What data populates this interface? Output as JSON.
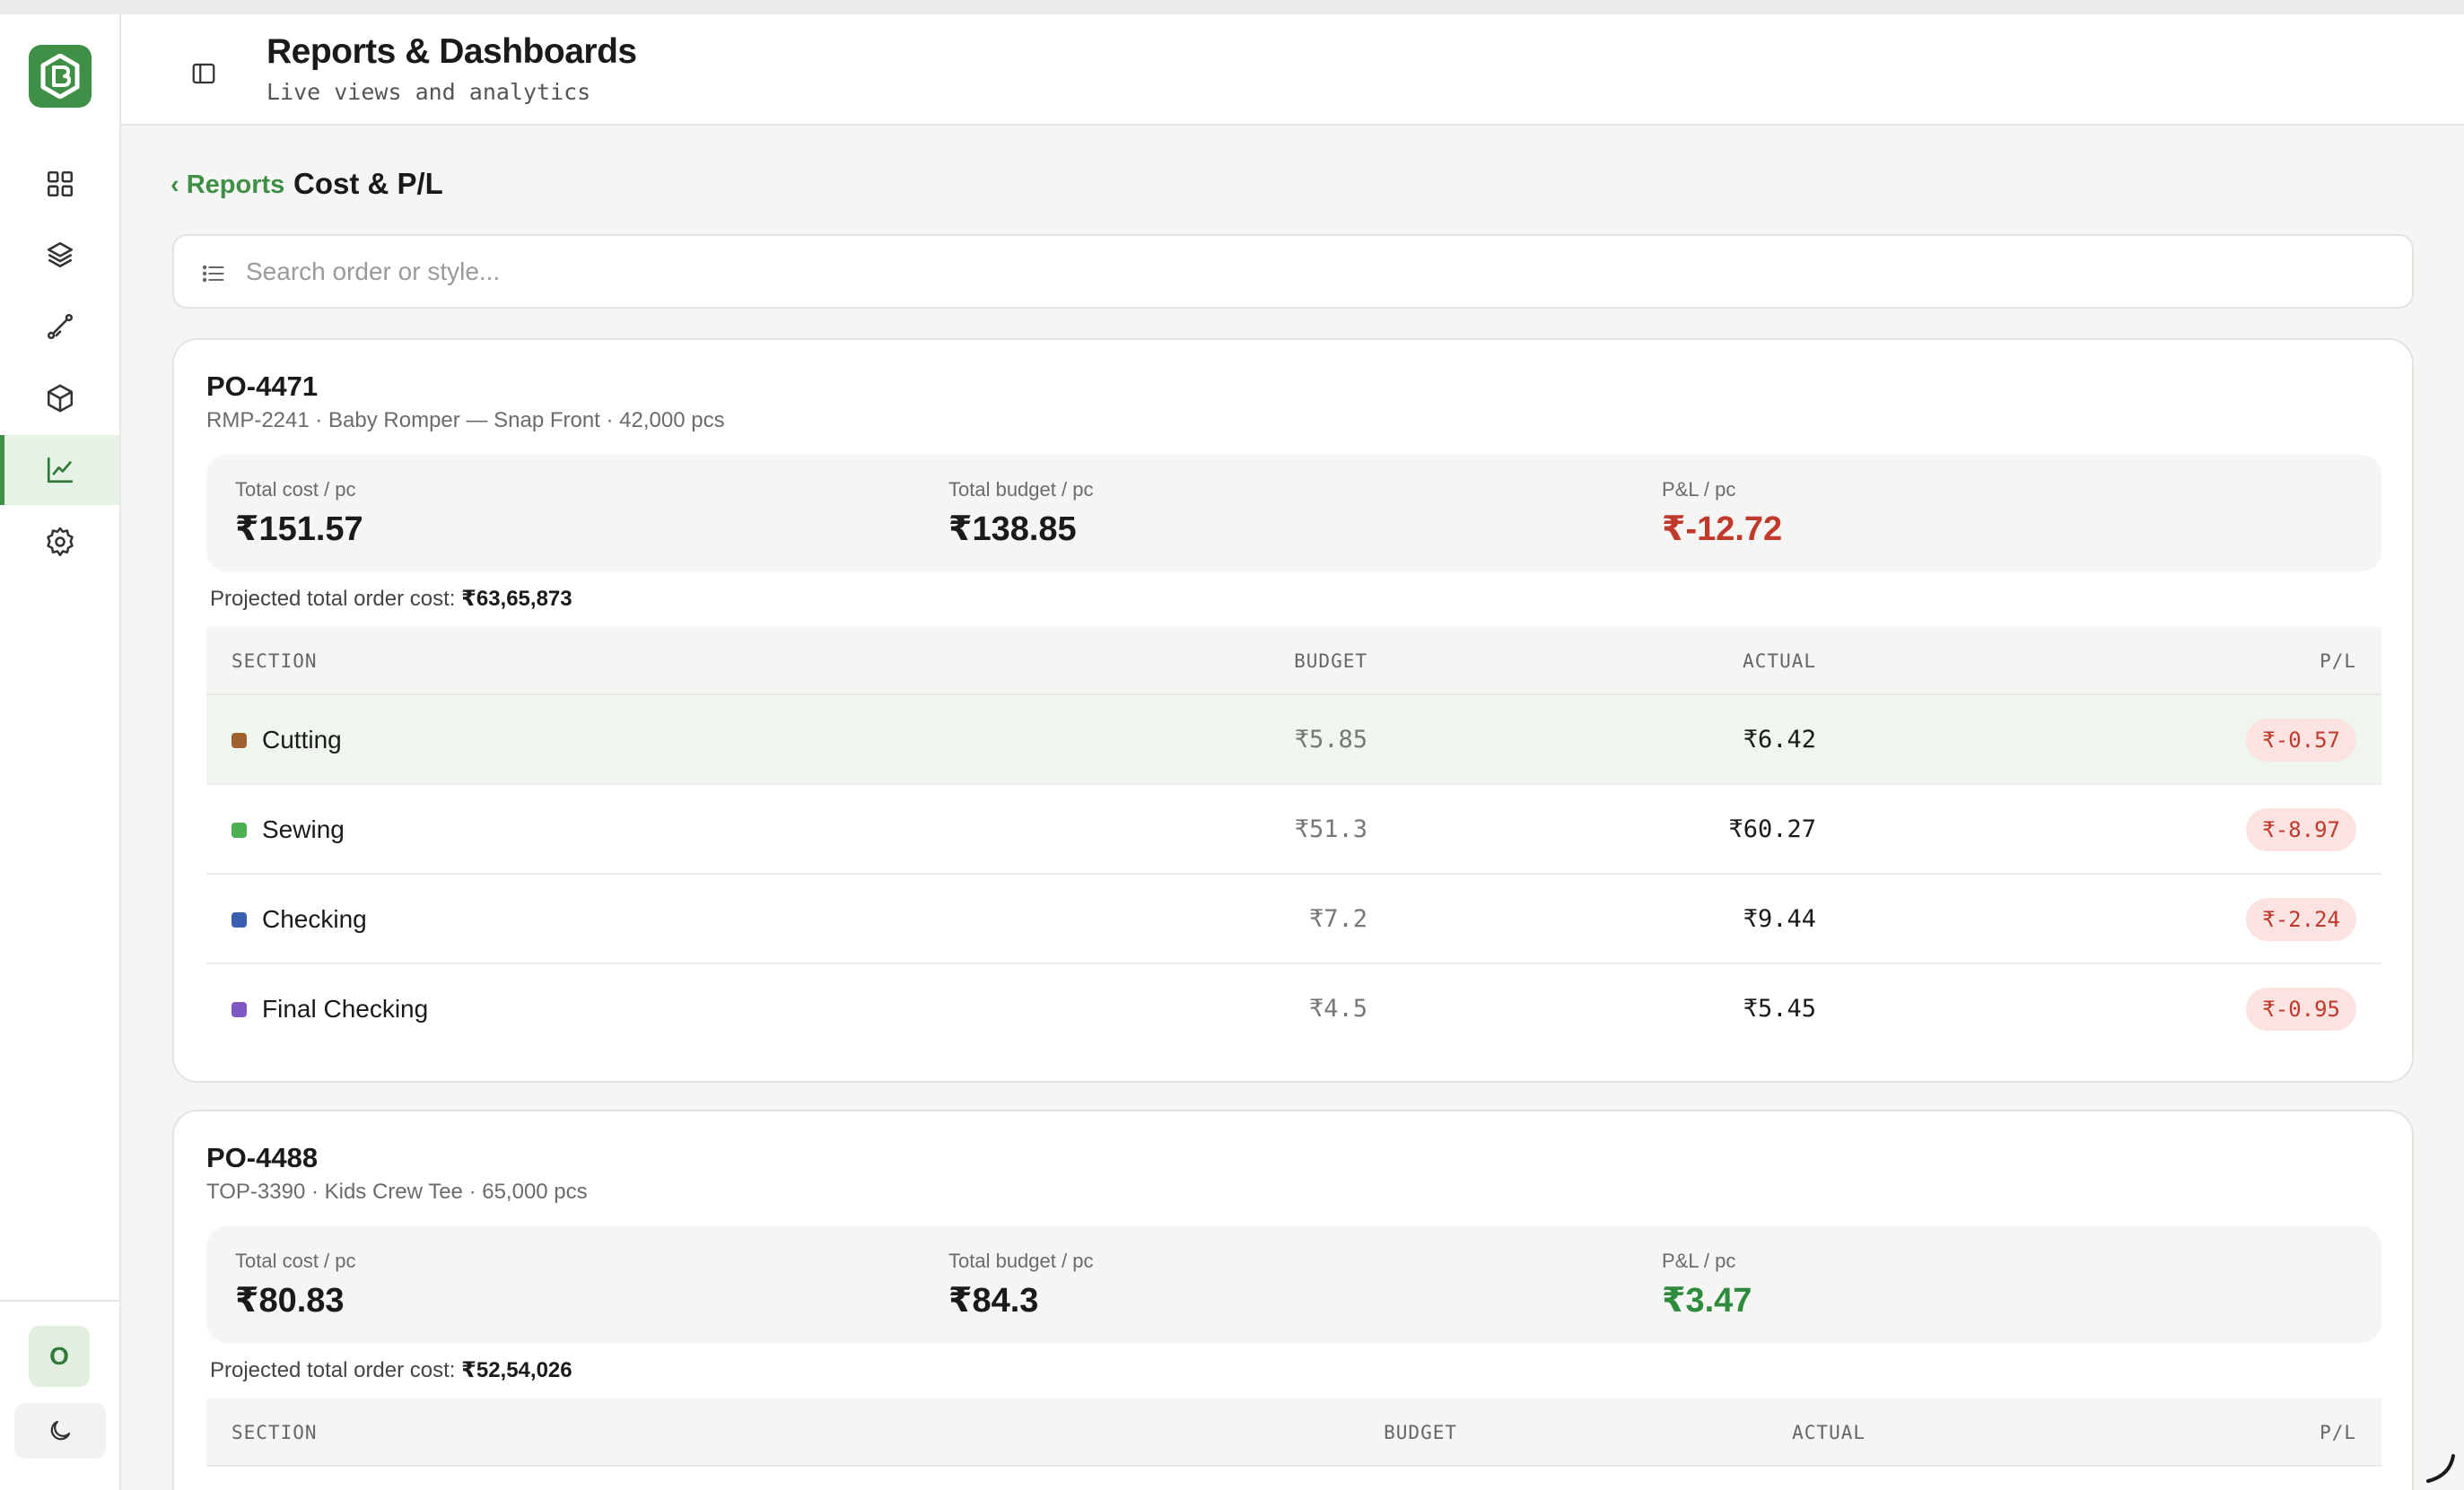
{
  "header": {
    "title": "Reports & Dashboards",
    "subtitle": "Live views and analytics"
  },
  "sidebar": {
    "logo_icon": "brand-logo-icon",
    "items": [
      {
        "icon": "grid-icon",
        "active": false
      },
      {
        "icon": "layers-icon",
        "active": false
      },
      {
        "icon": "route-icon",
        "active": false
      },
      {
        "icon": "box-icon",
        "active": false
      },
      {
        "icon": "chart-line-icon",
        "active": true
      },
      {
        "icon": "gear-icon",
        "active": false
      }
    ],
    "avatar_initial": "O",
    "theme_icon": "moon-icon"
  },
  "breadcrumb": {
    "back": "‹ Reports",
    "current": "Cost & P/L"
  },
  "search": {
    "placeholder": "Search order or style..."
  },
  "colors": {
    "accent": "#3f8f47",
    "negative": "#c0392b",
    "positive": "#2e8b3e"
  },
  "orders": [
    {
      "po": "PO-4471",
      "desc": "RMP-2241 · Baby Romper — Snap Front · 42,000 pcs",
      "stats": {
        "cost_label": "Total cost / pc",
        "cost": "₹151.57",
        "budget_label": "Total budget / pc",
        "budget": "₹138.85",
        "pl_label": "P&L / pc",
        "pl": "₹-12.72"
      },
      "projected_label": "Projected total order cost:",
      "projected": "₹63,65,873",
      "columns": [
        "SECTION",
        "BUDGET",
        "ACTUAL",
        "P/L"
      ],
      "rows": [
        {
          "section": "Cutting",
          "color": "#a0602e",
          "budget": "₹5.85",
          "actual": "₹6.42",
          "pl": "₹-0.57"
        },
        {
          "section": "Sewing",
          "color": "#4caf50",
          "budget": "₹51.3",
          "actual": "₹60.27",
          "pl": "₹-8.97"
        },
        {
          "section": "Checking",
          "color": "#3b5fb0",
          "budget": "₹7.2",
          "actual": "₹9.44",
          "pl": "₹-2.24"
        },
        {
          "section": "Final Checking",
          "color": "#7e57c2",
          "budget": "₹4.5",
          "actual": "₹5.45",
          "pl": "₹-0.95"
        }
      ]
    },
    {
      "po": "PO-4488",
      "desc": "TOP-3390 · Kids Crew Tee · 65,000 pcs",
      "stats": {
        "cost_label": "Total cost / pc",
        "cost": "₹80.83",
        "budget_label": "Total budget / pc",
        "budget": "₹84.3",
        "pl_label": "P&L / pc",
        "pl": "₹3.47"
      },
      "projected_label": "Projected total order cost:",
      "projected": "₹52,54,026",
      "columns": [
        "SECTION",
        "BUDGET",
        "ACTUAL",
        "P/L"
      ]
    }
  ]
}
